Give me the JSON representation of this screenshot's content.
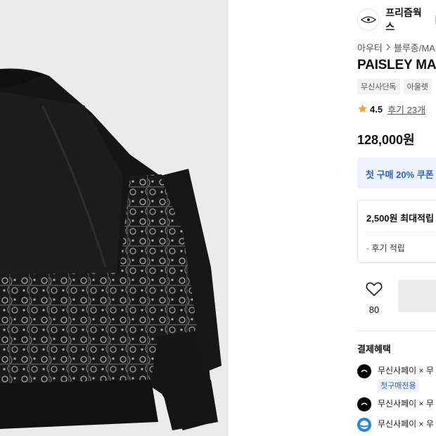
{
  "brand": {
    "name": "프리즘웍스",
    "logo_icon": "brand-logo-icon"
  },
  "breadcrumb": {
    "category": "아우터",
    "subcategory": "블루종/MA"
  },
  "product": {
    "title": "PAISLEY MA-",
    "tags": [
      "무신사단독",
      "아울렛"
    ],
    "rating": {
      "score": "4.5",
      "reviews": "후기 23개"
    },
    "price": "128,000원"
  },
  "coupon": {
    "text": "첫 구매 20% 쿠폰"
  },
  "points": {
    "max_label": "2,500원 최대적립",
    "review_label": "· 후기 적립"
  },
  "like": {
    "count": "80",
    "icon": "heart-outline-icon"
  },
  "payment": {
    "title": "결제혜택",
    "items": [
      {
        "text": "무신사페이 × 무",
        "badge": "첫구매전용",
        "icon_color": "#000000"
      },
      {
        "text": "무신사페이 × 무",
        "badge": "",
        "icon_color": "#000000"
      },
      {
        "text": "무신사페이 × 우",
        "badge": "",
        "icon_color": "#1e88e5"
      }
    ]
  },
  "colors": {
    "accent_blue": "#2f63c8",
    "star": "#f5a623",
    "image_bg": "#ebebeb"
  }
}
